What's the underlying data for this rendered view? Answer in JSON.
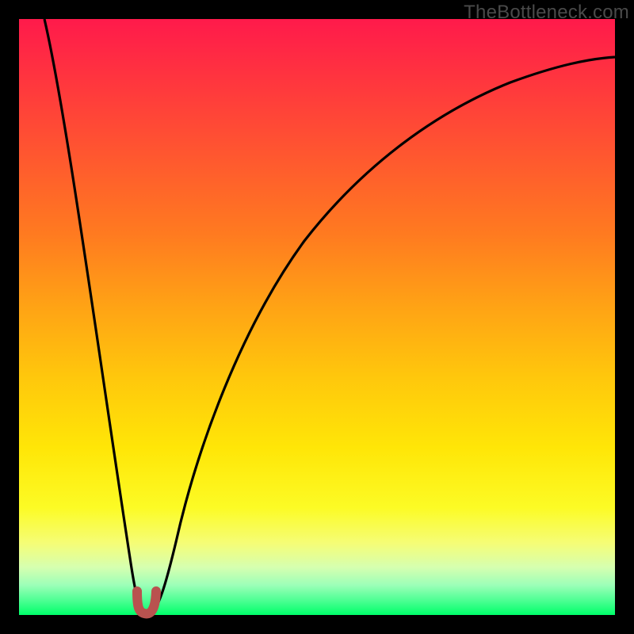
{
  "watermark": "TheBottleneck.com",
  "colors": {
    "curve_stroke": "#000000",
    "marker_stroke": "#b9524f",
    "frame_bg": "#000000"
  },
  "chart_data": {
    "type": "line",
    "title": "",
    "xlabel": "",
    "ylabel": "",
    "xlim": [
      0,
      100
    ],
    "ylim": [
      0,
      100
    ],
    "grid": false,
    "legend": false,
    "series": [
      {
        "name": "bottleneck-curve",
        "x": [
          0,
          2,
          5,
          8,
          11,
          14,
          17,
          19,
          20,
          21,
          22,
          24,
          27,
          31,
          36,
          42,
          49,
          57,
          66,
          76,
          87,
          100
        ],
        "y": [
          100,
          88,
          73,
          58,
          43,
          28,
          13,
          3,
          0,
          0,
          3,
          12,
          24,
          38,
          51,
          62,
          71,
          78,
          83,
          87,
          90,
          92
        ]
      }
    ],
    "marker": {
      "name": "optimal-point",
      "x": 20.5,
      "width": 3,
      "shape": "u"
    }
  }
}
